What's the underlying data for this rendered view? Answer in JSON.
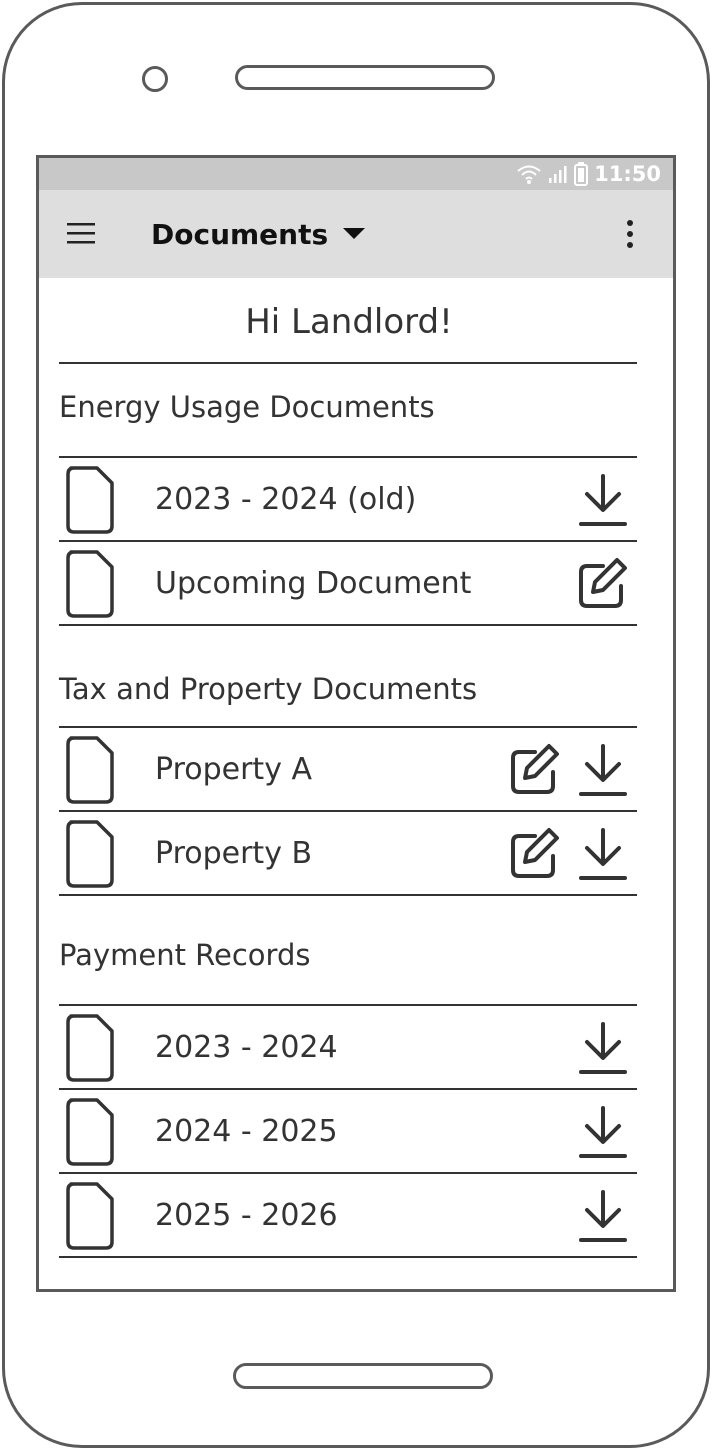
{
  "status_bar": {
    "time": "11:50",
    "icons": [
      "wifi-icon",
      "signal-icon",
      "battery-icon"
    ]
  },
  "app_bar": {
    "title": "Documents",
    "menu_icon": "hamburger-menu-icon",
    "dropdown_icon": "caret-down-icon",
    "overflow_icon": "more-vertical-icon"
  },
  "greeting": "Hi Landlord!",
  "sections": [
    {
      "title": "Energy Usage Documents",
      "items": [
        {
          "label": "2023 - 2024 (old)",
          "actions": [
            "download-icon"
          ]
        },
        {
          "label": "Upcoming Document",
          "actions": [
            "edit-icon"
          ]
        }
      ]
    },
    {
      "title": "Tax and Property Documents",
      "items": [
        {
          "label": "Property A",
          "actions": [
            "edit-icon",
            "download-icon"
          ]
        },
        {
          "label": "Property B",
          "actions": [
            "edit-icon",
            "download-icon"
          ]
        }
      ]
    },
    {
      "title": "Payment Records",
      "items": [
        {
          "label": "2023 - 2024",
          "actions": [
            "download-icon"
          ]
        },
        {
          "label": "2024 - 2025",
          "actions": [
            "download-icon"
          ]
        },
        {
          "label": "2025 - 2026",
          "actions": [
            "download-icon"
          ]
        }
      ]
    }
  ],
  "colors": {
    "app_bar_bg": "#dedede",
    "status_bar_bg": "#c8c8c8",
    "ink": "#333333",
    "device_frame": "#5a5a5a"
  }
}
